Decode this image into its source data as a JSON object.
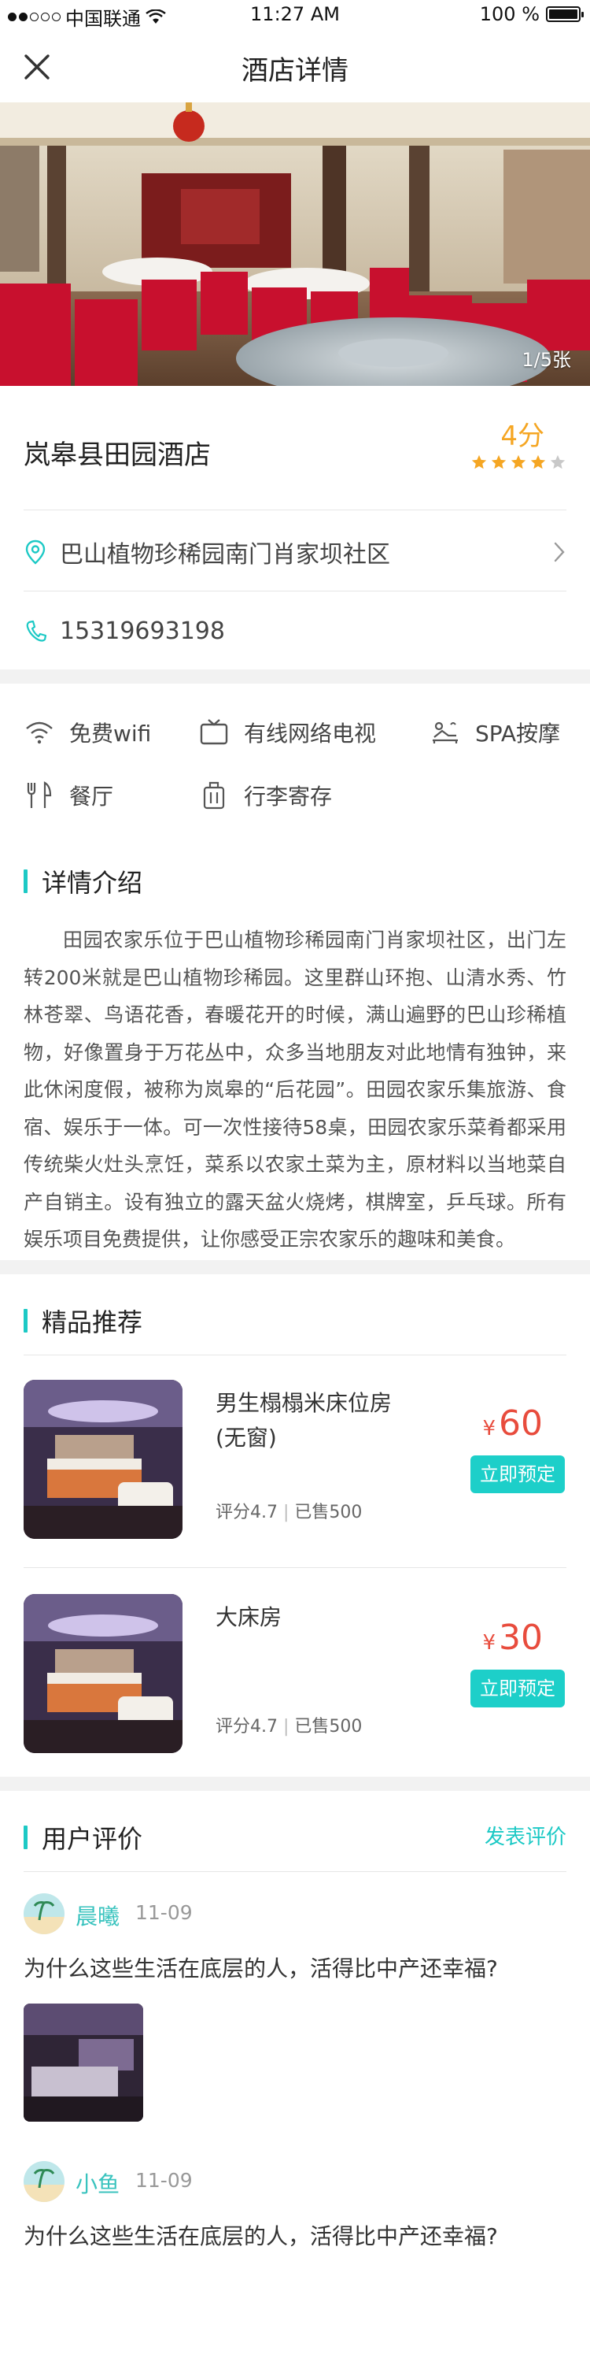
{
  "status_bar": {
    "carrier": "中国联通",
    "time": "11:27 AM",
    "battery": "100 %"
  },
  "nav": {
    "title": "酒店详情",
    "close_icon": "close-icon"
  },
  "hero": {
    "counter": "1/5张"
  },
  "hotel": {
    "name": "岚皋县田园酒店",
    "score": "4分",
    "rating": 4,
    "rating_max": 5
  },
  "address": "巴山植物珍稀园南门肖家坝社区",
  "phone": "15319693198",
  "amenities": [
    {
      "icon": "wifi-icon",
      "label": "免费wifi"
    },
    {
      "icon": "tv-icon",
      "label": "有线网络电视"
    },
    {
      "icon": "spa-icon",
      "label": "SPA按摩"
    },
    {
      "icon": "restaurant-icon",
      "label": "餐厅"
    },
    {
      "icon": "luggage-icon",
      "label": "行李寄存"
    }
  ],
  "details": {
    "title": "详情介绍",
    "text": "田园农家乐位于巴山植物珍稀园南门肖家坝社区，出门左转200米就是巴山植物珍稀园。这里群山环抱、山清水秀、竹林苍翠、鸟语花香，春暖花开的时候，满山遍野的巴山珍稀植物，好像置身于万花丛中，众多当地朋友对此地情有独钟，来此休闲度假，被称为岚皋的“后花园”。田园农家乐集旅游、食宿、娱乐于一体。可一次性接待58桌，田园农家乐菜肴都采用传统柴火灶头烹饪，菜系以农家土菜为主，原材料以当地菜自产自销主。设有独立的露天盆火烧烤，棋牌室，乒乓球。所有娱乐项目免费提供，让你感受正宗农家乐的趣味和美食。"
  },
  "recommend": {
    "title": "精品推荐",
    "rooms": [
      {
        "name": "男生榻榻米床位房(无窗)",
        "price": "60",
        "currency": "¥",
        "rating": "评分4.7",
        "sold": "已售500",
        "book": "立即预定"
      },
      {
        "name": "大床房",
        "price": "30",
        "currency": "¥",
        "rating": "评分4.7",
        "sold": "已售500",
        "book": "立即预定"
      }
    ]
  },
  "reviews": {
    "title": "用户评价",
    "write_link": "发表评价",
    "items": [
      {
        "user": "晨曦",
        "date": "11-09",
        "text": "为什么这些生活在底层的人，活得比中产还幸福?",
        "has_image": true
      },
      {
        "user": "小鱼",
        "date": "11-09",
        "text": "为什么这些生活在底层的人，活得比中产还幸福?",
        "has_image": false
      }
    ]
  },
  "colors": {
    "accent": "#1cc9c5",
    "price": "#e84c3d",
    "score": "#f5a623"
  }
}
